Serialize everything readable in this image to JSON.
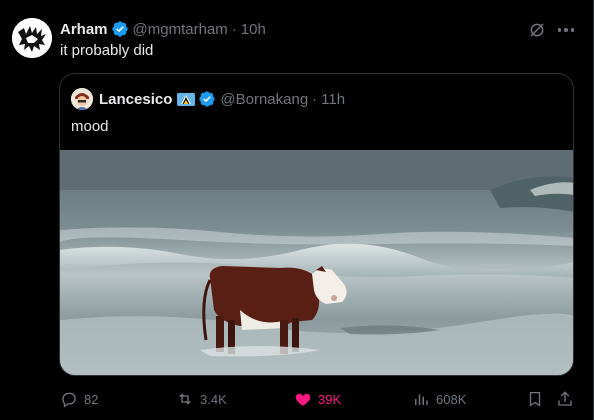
{
  "tweet": {
    "author_name": "Arham",
    "handle": "@mgmtarham",
    "time": "10h",
    "separator": "·",
    "text": "it probably did"
  },
  "quoted": {
    "author_name": "Lancesico",
    "handle": "@Bornakang",
    "time": "11h",
    "separator": "·",
    "text": "mood",
    "media_description_icon": "cow-on-beach-photo"
  },
  "actions": {
    "replies": "82",
    "reposts": "3.4K",
    "likes": "39K",
    "views": "608K"
  },
  "colors": {
    "background": "#000000",
    "text_primary": "#e7e9ea",
    "text_secondary": "#71767b",
    "verified": "#1d9bf0",
    "like": "#f91880",
    "border": "#2f3336"
  },
  "icons": [
    "verified-badge-icon",
    "grok-icon",
    "more-icon",
    "reply-icon",
    "repost-icon",
    "like-icon",
    "views-icon",
    "bookmark-icon",
    "share-icon",
    "flag-icon"
  ]
}
